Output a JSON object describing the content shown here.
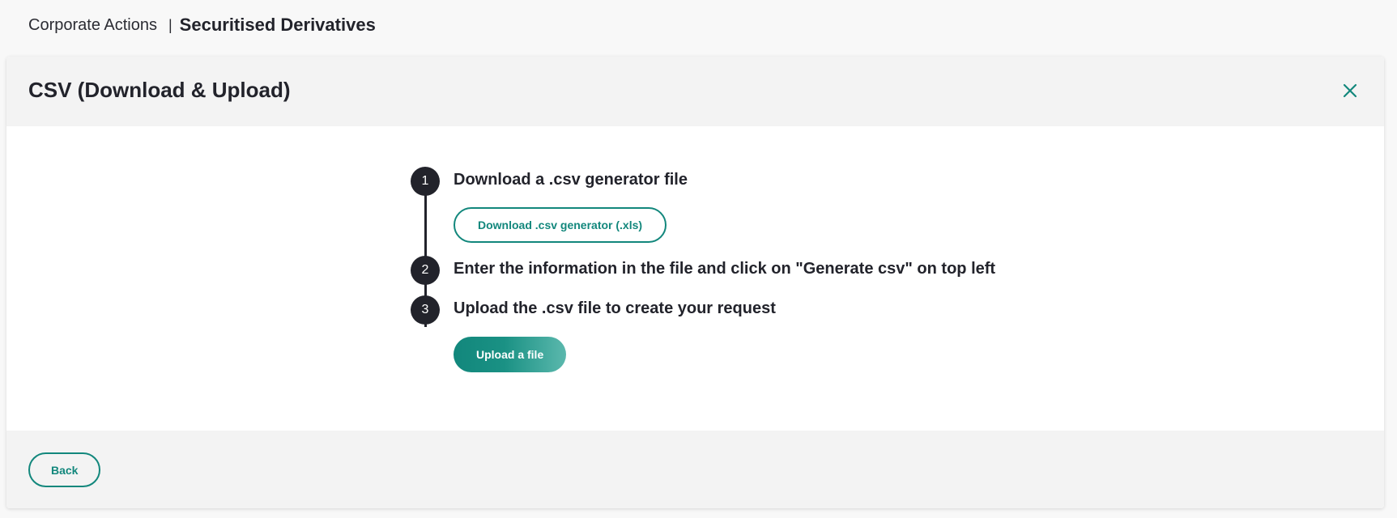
{
  "breadcrumb": {
    "parent": "Corporate Actions",
    "separator": "|",
    "current": "Securitised Derivatives"
  },
  "card": {
    "title": "CSV (Download & Upload)",
    "close_icon": "close-icon"
  },
  "steps": [
    {
      "number": "1",
      "text": "Download a .csv generator file",
      "button_label": "Download .csv generator (.xls)"
    },
    {
      "number": "2",
      "text": "Enter the information in the file and click on \"Generate csv\" on top left"
    },
    {
      "number": "3",
      "text": "Upload the .csv file to create your request",
      "button_label": "Upload a file"
    }
  ],
  "footer": {
    "back_label": "Back"
  },
  "colors": {
    "accent": "#12877c",
    "dark": "#22232b",
    "header_bg": "#f3f3f3",
    "page_bg": "#f8f8f8"
  }
}
